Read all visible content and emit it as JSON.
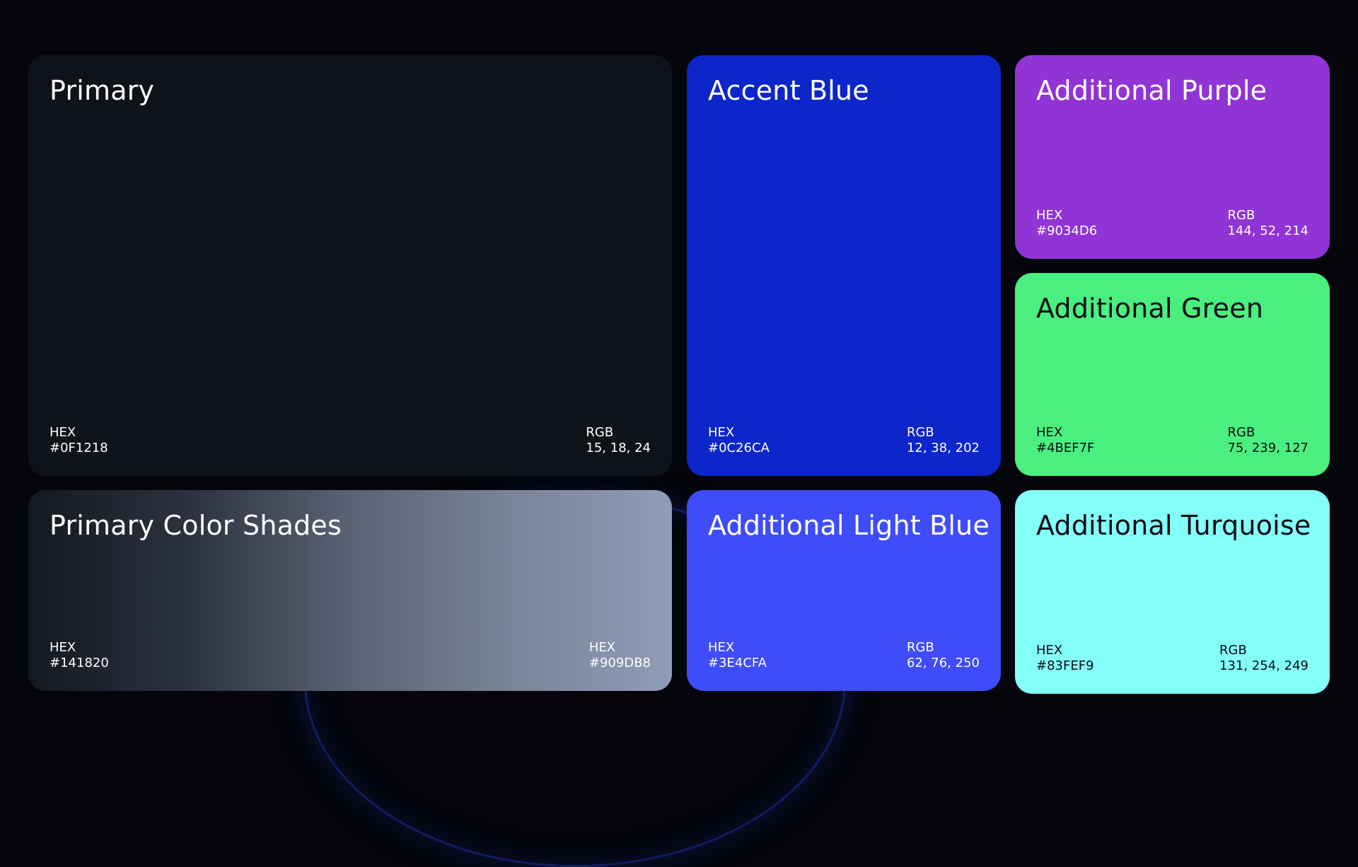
{
  "cards": {
    "primary": {
      "title": "Primary",
      "left_label": "HEX",
      "left_value": "#0F1218",
      "right_label": "RGB",
      "right_value": "15, 18, 24",
      "color": "#0F1218"
    },
    "accent_blue": {
      "title": "Accent Blue",
      "left_label": "HEX",
      "left_value": "#0C26CA",
      "right_label": "RGB",
      "right_value": "12, 38, 202",
      "color": "#0C26CA"
    },
    "purple": {
      "title": "Additional Purple",
      "left_label": "HEX",
      "left_value": "#9034D6",
      "right_label": "RGB",
      "right_value": "144, 52, 214",
      "color": "#9034D6"
    },
    "green": {
      "title": "Additional Green",
      "left_label": "HEX",
      "left_value": "#4BEF7F",
      "right_label": "RGB",
      "right_value": "75, 239, 127",
      "color": "#4BEF7F"
    },
    "shades": {
      "title": "Primary Color Shades",
      "left_label": "HEX",
      "left_value": "#141820",
      "right_label": "HEX",
      "right_value": "#909DB8",
      "gradient": [
        "#141820",
        "#909DB8"
      ]
    },
    "light_blue": {
      "title": "Additional Light Blue",
      "left_label": "HEX",
      "left_value": "#3E4CFA",
      "right_label": "RGB",
      "right_value": "62, 76, 250",
      "color": "#3E4CFA"
    },
    "turquoise": {
      "title": "Additional Turquoise",
      "left_label": "HEX",
      "left_value": "#83FEF9",
      "right_label": "RGB",
      "right_value": "131, 254, 249",
      "color": "#83FEF9"
    }
  }
}
